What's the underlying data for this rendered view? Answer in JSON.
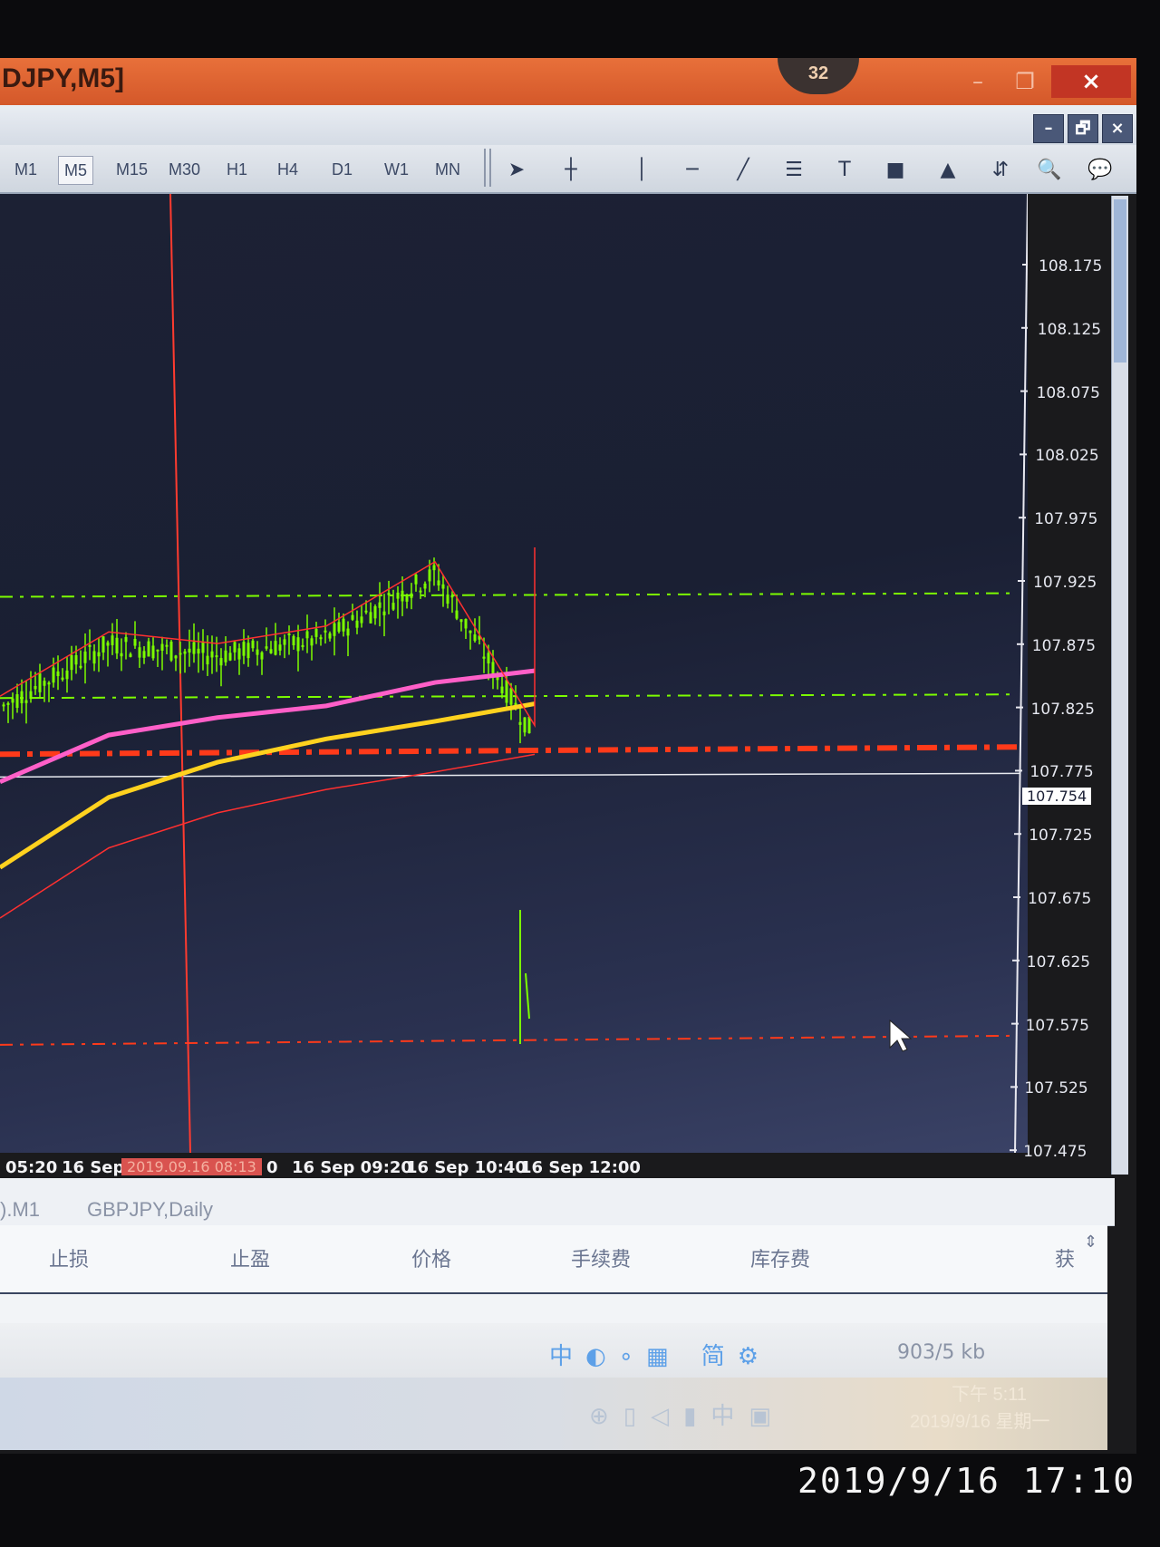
{
  "window": {
    "title": "DJPY,M5]",
    "badge": "32",
    "close_label": "×",
    "minimize_label": "–",
    "maximize_label": "❐"
  },
  "mdi": {
    "minimize_label": "–",
    "restore_label": "🗗",
    "close_label": "×"
  },
  "timeframes": [
    "M1",
    "M5",
    "M15",
    "M30",
    "H1",
    "H4",
    "D1",
    "W1",
    "MN"
  ],
  "active_timeframe": "M5",
  "price_axis": {
    "labels": [
      "108.175",
      "108.125",
      "108.075",
      "108.025",
      "107.975",
      "107.925",
      "107.875",
      "107.825",
      "107.775",
      "107.725",
      "107.675",
      "107.625",
      "107.575",
      "107.525",
      "107.475"
    ],
    "current_price": "107.754"
  },
  "time_axis": {
    "labels": [
      "05:20",
      "16 Sep",
      "0",
      "16 Sep 09:20",
      "16 Sep 10:40",
      "16 Sep 12:00"
    ],
    "marker": "2019.09.16 08:13"
  },
  "tabs": [
    ").M1",
    "GBPJPY,Daily"
  ],
  "table_headers": [
    "止损",
    "止盈",
    "价格",
    "手续费",
    "库存费"
  ],
  "table_extra": "获",
  "status": {
    "traffic": "903/5 kb"
  },
  "taskbar": {
    "time": "下午 5:11",
    "date": "2019/9/16 星期一"
  },
  "photo_timestamp": "2019/9/16  17:10",
  "colors": {
    "chart_bg": "#1c2134",
    "candle": "#7cfc00",
    "ma_pink": "#ff5fc8",
    "ma_yellow": "#ffd21f",
    "bollinger": "#ff3030",
    "level_green": "#7cfc00",
    "level_red": "#ff3a1a"
  },
  "chart_data": {
    "type": "line",
    "title": "",
    "xlabel": "",
    "ylabel": "",
    "ylim": [
      107.475,
      108.2
    ],
    "x": [
      "05:20",
      "06:40",
      "08:00",
      "09:20",
      "10:40",
      "12:00"
    ],
    "series": [
      {
        "values": [
          107.785,
          107.84,
          107.83,
          107.845,
          107.9,
          107.76
        ]
      },
      {
        "values": [
          107.77,
          107.81,
          107.825,
          107.835,
          107.855,
          107.865
        ]
      },
      {
        "values": [
          107.72,
          107.78,
          107.81,
          107.83,
          107.845,
          107.86
        ]
      }
    ],
    "horizontal_levels": [
      107.905,
      107.82,
      107.775,
      107.528,
      107.754
    ],
    "grid": false
  }
}
